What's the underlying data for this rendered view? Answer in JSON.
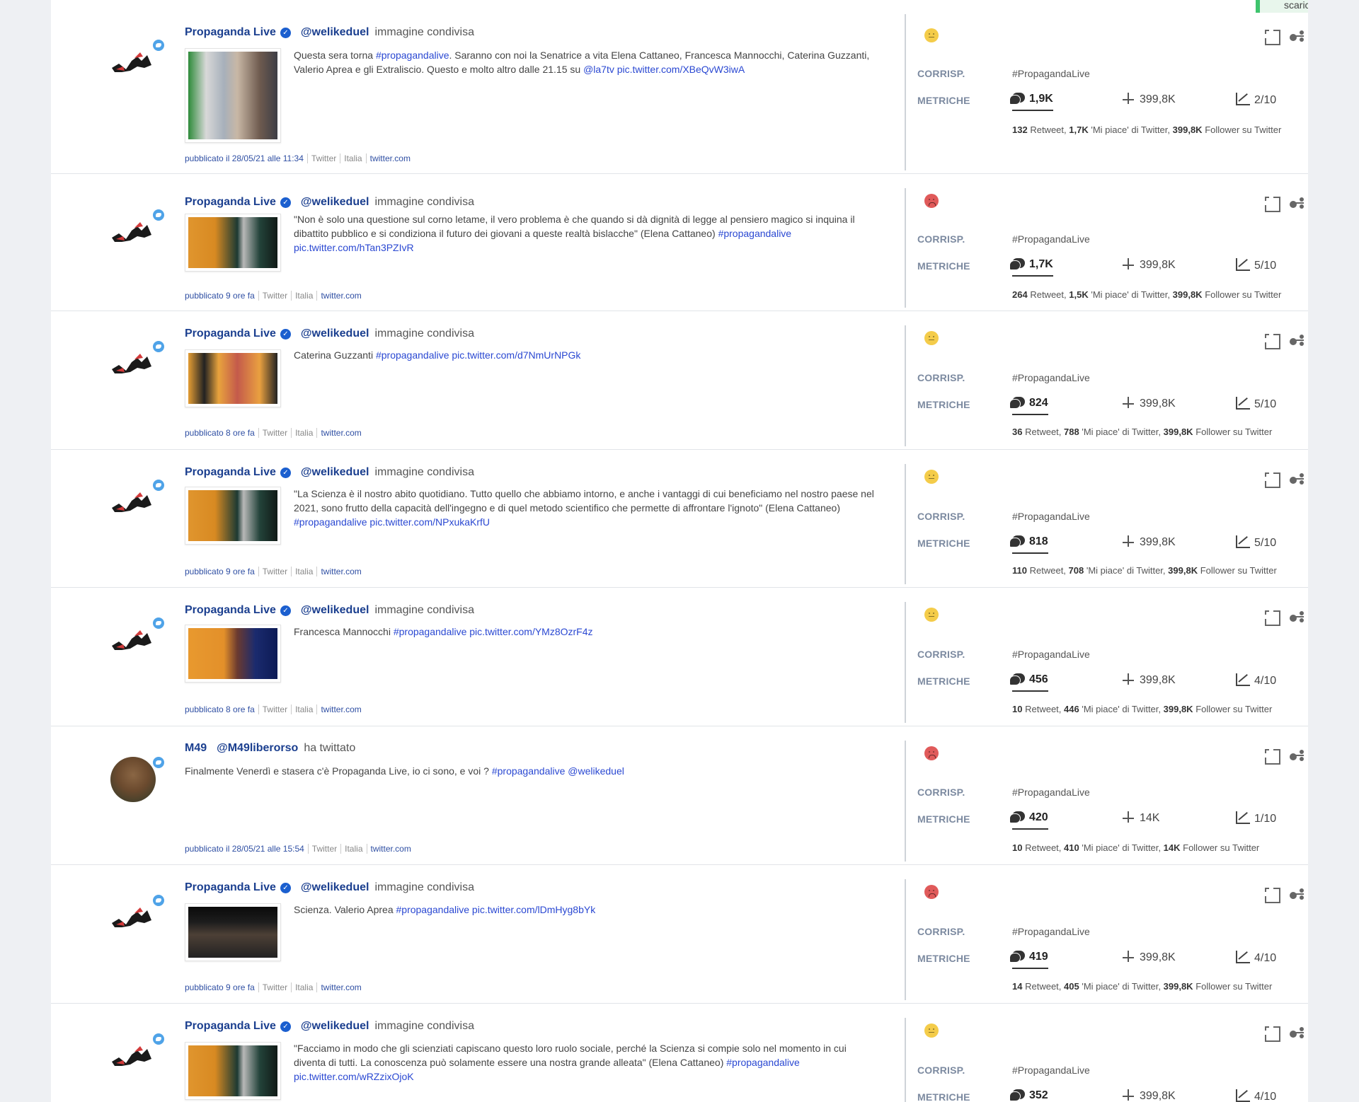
{
  "toast": {
    "text": "scaricano"
  },
  "labels": {
    "corrisp": "CORRISP.",
    "metriche": "METRICHE"
  },
  "meta_labels": {
    "platform": "Twitter",
    "country": "Italia",
    "site": "twitter.com"
  },
  "foot_labels": {
    "retweet": "Retweet,",
    "likes": "'Mi piace' di Twitter,",
    "followers": "Follower su Twitter"
  },
  "colors": {
    "neutral_sentiment": "#f4cc4a",
    "negative_sentiment": "#e05a5a",
    "link": "#2a48d2",
    "author": "#1b3f8f"
  },
  "items": [
    {
      "author": "Propaganda Live",
      "verified": true,
      "handle": "@welikeduel",
      "action": "immagine condivisa",
      "avatar": "propaganda-logo",
      "thumb": "elena-cattaneo-portrait",
      "text_plain": "Questa sera torna ",
      "text_tag": "#propagandalive",
      "text_after": ". Saranno con noi la Senatrice a vita Elena Cattaneo, Francesca Mannocchi, Caterina Guzzanti, Valerio Aprea e gli Extraliscio. Questo e molto altro dalle 21.15 su ",
      "text_link": "@la7tv pic.twitter.com/XBeQvW3iwA",
      "published": "pubblicato il 28/05/21 alle 11:34",
      "sentiment": "neutral",
      "tag": "#PropagandaLive",
      "comments": "1,9K",
      "reach": "399,8K",
      "score": "2/10",
      "retweets": "132",
      "likes": "1,7K",
      "followers": "399,8K"
    },
    {
      "author": "Propaganda Live",
      "verified": true,
      "handle": "@welikeduel",
      "action": "immagine condivisa",
      "avatar": "propaganda-logo",
      "thumb": "elena-cattaneo-studio",
      "text_plain": "\"Non è solo una questione sul corno letame, il vero problema è che quando si dà dignità di legge al pensiero magico si inquina il dibattito pubblico e si condiziona il futuro dei giovani a queste realtà bislacche\" (Elena Cattaneo) ",
      "text_tag": "#propagandalive",
      "text_after": " ",
      "text_link": "pic.twitter.com/hTan3PZIvR",
      "published": "pubblicato 9 ore fa",
      "sentiment": "negative",
      "tag": "#PropagandaLive",
      "comments": "1,7K",
      "reach": "399,8K",
      "score": "5/10",
      "retweets": "264",
      "likes": "1,5K",
      "followers": "399,8K"
    },
    {
      "author": "Propaganda Live",
      "verified": true,
      "handle": "@welikeduel",
      "action": "immagine condivisa",
      "avatar": "propaganda-logo",
      "thumb": "caterina-guzzanti",
      "text_plain": "Caterina Guzzanti ",
      "text_tag": "#propagandalive",
      "text_after": " ",
      "text_link": "pic.twitter.com/d7NmUrNPGk",
      "published": "pubblicato 8 ore fa",
      "sentiment": "neutral",
      "tag": "#PropagandaLive",
      "comments": "824",
      "reach": "399,8K",
      "score": "5/10",
      "retweets": "36",
      "likes": "788",
      "followers": "399,8K"
    },
    {
      "author": "Propaganda Live",
      "verified": true,
      "handle": "@welikeduel",
      "action": "immagine condivisa",
      "avatar": "propaganda-logo",
      "thumb": "elena-cattaneo-studio",
      "text_plain": "\"La Scienza è il nostro abito quotidiano. Tutto quello che abbiamo intorno, e anche i vantaggi di cui beneficiamo nel nostro paese nel 2021, sono frutto della capacità dell'ingegno e di quel metodo scientifico che permette di affrontare l'ignoto\" (Elena Cattaneo) ",
      "text_tag": "#propagandalive",
      "text_after": " ",
      "text_link": "pic.twitter.com/NPxukaKrfU",
      "published": "pubblicato 9 ore fa",
      "sentiment": "neutral",
      "tag": "#PropagandaLive",
      "comments": "818",
      "reach": "399,8K",
      "score": "5/10",
      "retweets": "110",
      "likes": "708",
      "followers": "399,8K"
    },
    {
      "author": "Propaganda Live",
      "verified": true,
      "handle": "@welikeduel",
      "action": "immagine condivisa",
      "avatar": "propaganda-logo",
      "thumb": "francesca-mannocchi",
      "text_plain": "Francesca Mannocchi ",
      "text_tag": "#propagandalive",
      "text_after": " ",
      "text_link": "pic.twitter.com/YMz8OzrF4z",
      "published": "pubblicato 8 ore fa",
      "sentiment": "neutral",
      "tag": "#PropagandaLive",
      "comments": "456",
      "reach": "399,8K",
      "score": "4/10",
      "retweets": "10",
      "likes": "446",
      "followers": "399,8K"
    },
    {
      "author": "M49",
      "verified": false,
      "handle": "@M49liberorso",
      "action": "ha twittato",
      "avatar": "bear-photo",
      "thumb": "",
      "text_plain": "Finalmente Venerdì e stasera c'è Propaganda Live, io ci sono, e voi ? ",
      "text_tag": "#propagandalive",
      "text_after": " ",
      "text_link": "@welikeduel",
      "published": "pubblicato il 28/05/21 alle 15:54",
      "sentiment": "negative",
      "tag": "#PropagandaLive",
      "comments": "420",
      "reach": "14K",
      "score": "1/10",
      "retweets": "10",
      "likes": "410",
      "followers": "14K"
    },
    {
      "author": "Propaganda Live",
      "verified": true,
      "handle": "@welikeduel",
      "action": "immagine condivisa",
      "avatar": "propaganda-logo",
      "thumb": "valerio-aprea",
      "text_plain": "Scienza. Valerio Aprea ",
      "text_tag": "#propagandalive",
      "text_after": " ",
      "text_link": "pic.twitter.com/lDmHyg8bYk",
      "published": "pubblicato 9 ore fa",
      "sentiment": "negative",
      "tag": "#PropagandaLive",
      "comments": "419",
      "reach": "399,8K",
      "score": "4/10",
      "retweets": "14",
      "likes": "405",
      "followers": "399,8K"
    },
    {
      "author": "Propaganda Live",
      "verified": true,
      "handle": "@welikeduel",
      "action": "immagine condivisa",
      "avatar": "propaganda-logo",
      "thumb": "elena-cattaneo-studio",
      "text_plain": "\"Facciamo in modo che gli scienziati capiscano questo loro ruolo sociale, perché la Scienza si compie solo nel momento in cui diventa di tutti. La conoscenza può solamente essere una nostra grande alleata\" (Elena Cattaneo) ",
      "text_tag": "#propagandalive",
      "text_after": " ",
      "text_link": "pic.twitter.com/wRZzixOjoK",
      "published": "",
      "sentiment": "neutral",
      "tag": "#PropagandaLive",
      "comments": "352",
      "reach": "399,8K",
      "score": "4/10",
      "retweets": "",
      "likes": "",
      "followers": ""
    }
  ]
}
